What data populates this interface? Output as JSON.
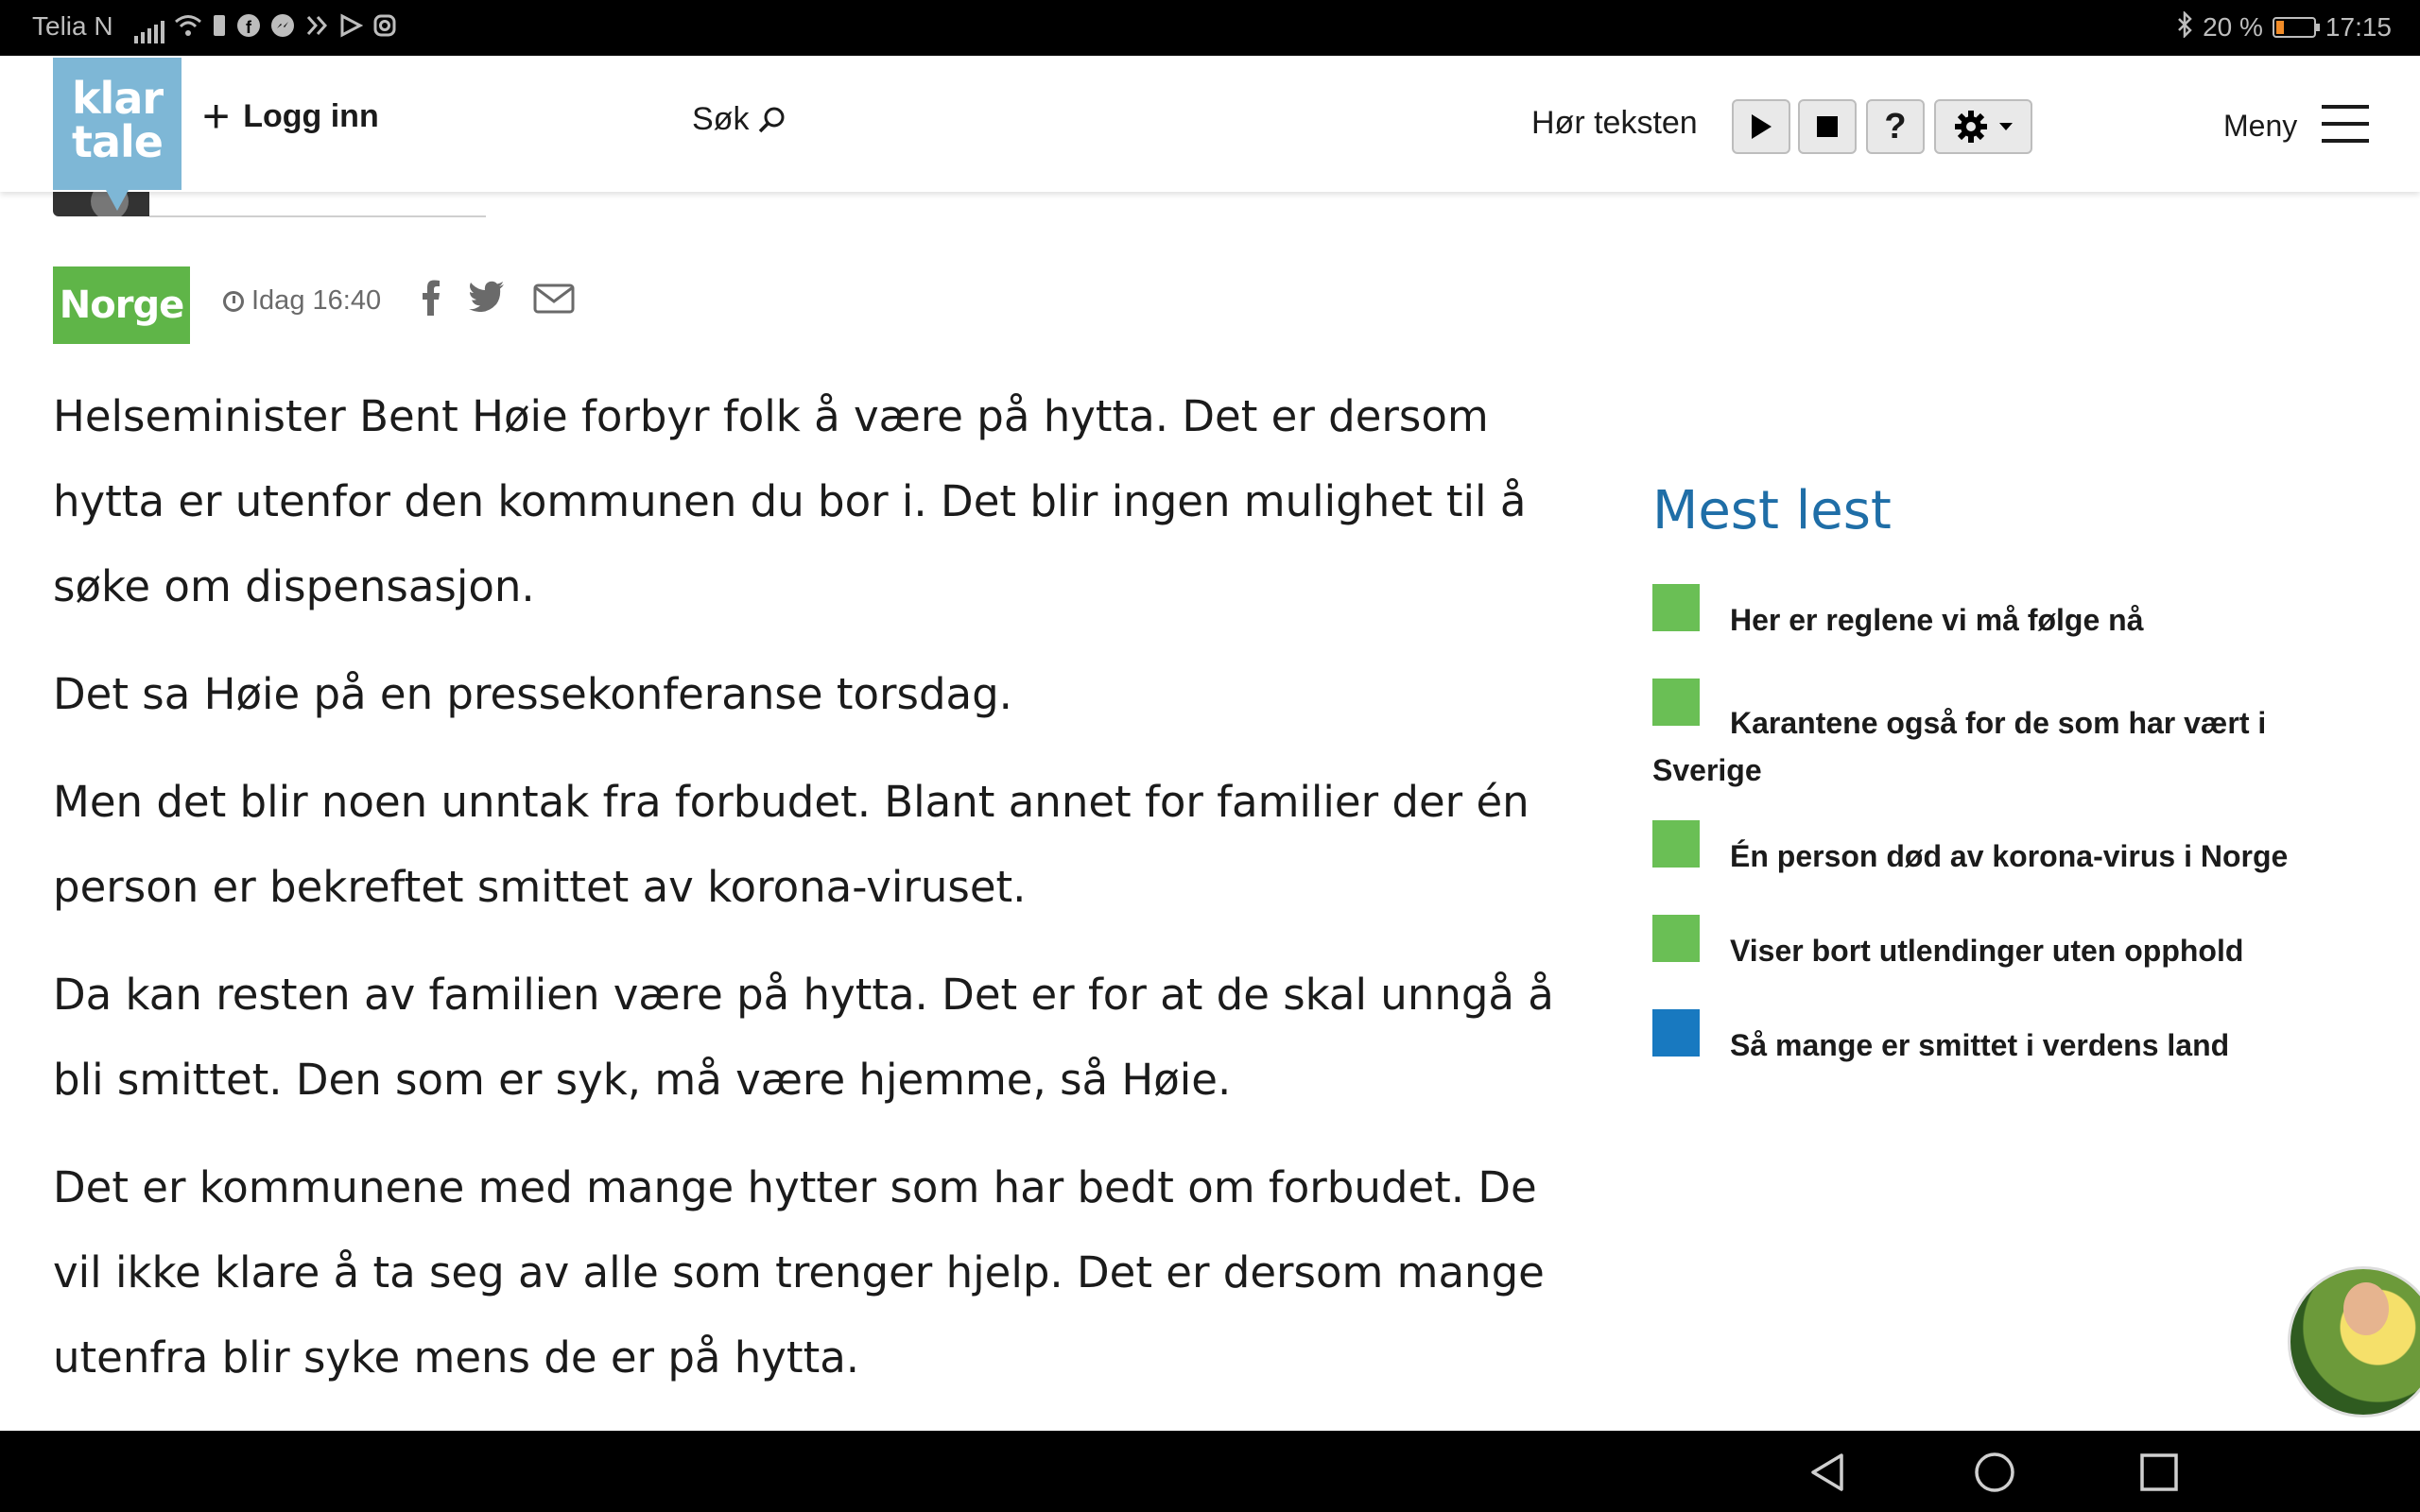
{
  "statusbar": {
    "carrier": "Telia N",
    "battery_text": "20 %",
    "battery_level": 0.2,
    "time": "17:15",
    "icons": [
      "signal-icon",
      "wifi-icon",
      "sim-icon",
      "facebook-icon",
      "messenger-icon",
      "app-icon",
      "play-store-icon",
      "instagram-icon"
    ]
  },
  "header": {
    "logo_line1": "klar",
    "logo_line2": "tale",
    "login_label": "Logg inn",
    "search_label": "Søk",
    "listen_label": "Hør teksten",
    "help_label": "?",
    "menu_label": "Meny"
  },
  "article": {
    "category": "Norge",
    "time": "Idag 16:40",
    "paragraphs": [
      "Helseminister Bent Høie forbyr folk å være på hytta. Det er dersom hytta er utenfor den kommunen du bor i. Det blir ingen mulighet til å søke om dispensasjon.",
      "Det sa Høie på en pressekonferanse torsdag.",
      "Men det blir noen unntak fra forbudet. Blant annet for familier der én person er bekreftet smittet av korona-viruset.",
      "Da kan resten av familien være på hytta. Det er for at de skal unngå å bli smittet. Den som er syk, må være hjemme, så Høie.",
      "Det er kommunene med mange hytter som har bedt om forbudet. De vil ikke klare å ta seg av alle som trenger hjelp. Det er dersom mange utenfra blir syke mens de er på hytta."
    ]
  },
  "most_read": {
    "title": "Mest lest",
    "items": [
      {
        "label": "Her er reglene vi må følge nå",
        "color": "#6abf55"
      },
      {
        "label": "Karantene også for de som har vært i Sverige",
        "color": "#6abf55"
      },
      {
        "label": "Én person død av korona-virus i Norge",
        "color": "#6abf55"
      },
      {
        "label": "Viser bort utlendinger uten opphold",
        "color": "#6abf55"
      },
      {
        "label": "Så mange er smittet i verdens land",
        "color": "#1879c0"
      }
    ]
  },
  "colors": {
    "category_green": "#5fb548",
    "heading_blue": "#1f6ea7",
    "logo_blue": "#7eb7d6"
  }
}
